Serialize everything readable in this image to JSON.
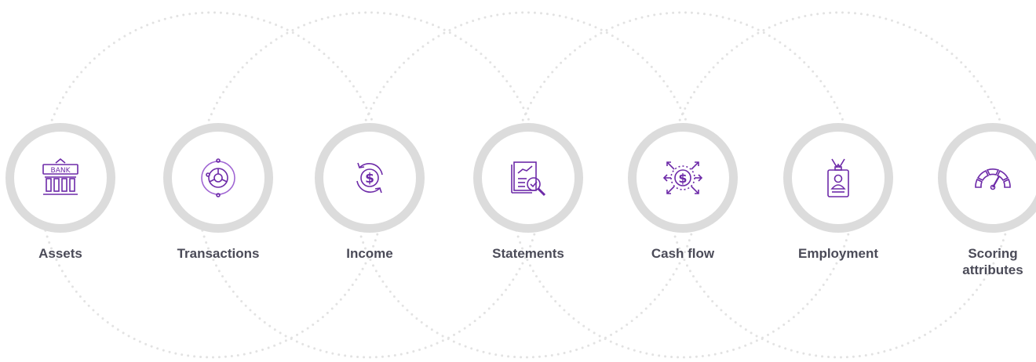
{
  "colors": {
    "accent": "#6d2aa8",
    "ring": "#dcdcdc",
    "text": "#4b4b58",
    "dots": "#e2e2e2"
  },
  "items": [
    {
      "label": "Assets",
      "icon": "bank-icon",
      "icon_text": "BANK"
    },
    {
      "label": "Transactions",
      "icon": "transactions-cycle-icon"
    },
    {
      "label": "Income",
      "icon": "dollar-refresh-icon"
    },
    {
      "label": "Statements",
      "icon": "statement-magnifier-icon"
    },
    {
      "label": "Cash flow",
      "icon": "dollar-arrows-icon"
    },
    {
      "label": "Employment",
      "icon": "id-badge-icon"
    },
    {
      "label": "Scoring attributes",
      "icon": "speedometer-icon"
    }
  ]
}
